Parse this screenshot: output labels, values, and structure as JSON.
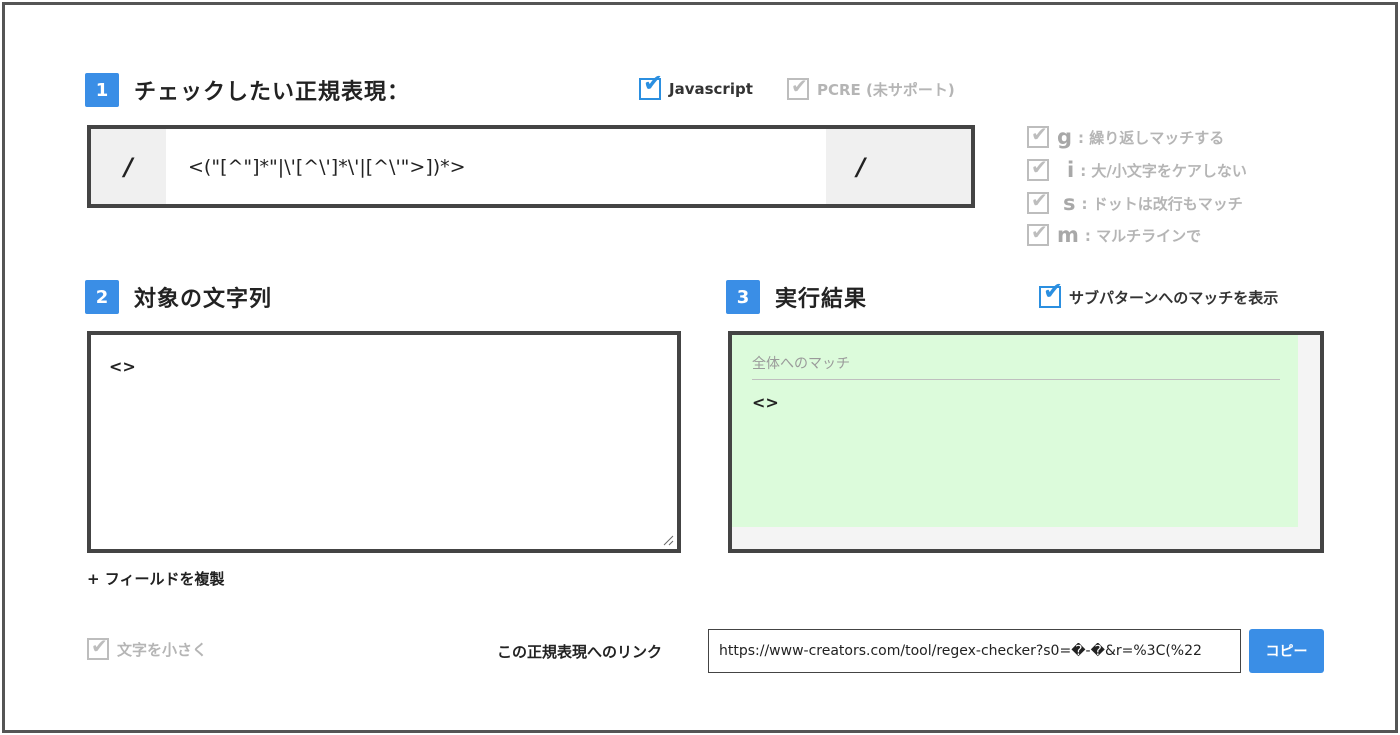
{
  "step1": {
    "number": "1",
    "title": "チェックしたい正規表現："
  },
  "engines": {
    "javascript": {
      "label": "Javascript",
      "checked": true
    },
    "pcre": {
      "label": "PCRE (未サポート)",
      "checked": true
    }
  },
  "regex": {
    "open_delim": "/",
    "pattern": "<(\"[^\"]*\"|\\'[^\\']*\\'|[^\\'\">])*>",
    "close_delim": "/"
  },
  "flags": [
    {
      "key": "g",
      "label": ": 繰り返しマッチする",
      "checked": true
    },
    {
      "key": "i",
      "label": ": 大/小文字をケアしない",
      "checked": true
    },
    {
      "key": "s",
      "label": ": ドットは改行もマッチ",
      "checked": true
    },
    {
      "key": "m",
      "label": ": マルチラインで",
      "checked": true
    }
  ],
  "step2": {
    "number": "2",
    "title": "対象の文字列"
  },
  "target": {
    "text": "<>"
  },
  "step3": {
    "number": "3",
    "title": "実行結果"
  },
  "submatch": {
    "label": "サブパターンへのマッチを表示",
    "checked": true
  },
  "result": {
    "header": "全体へのマッチ",
    "value": "<>"
  },
  "duplicate_label": "+ フィールドを複製",
  "small_text": {
    "label": "文字を小さく",
    "checked": true
  },
  "link": {
    "label": "この正規表現へのリンク",
    "url": "https://www-creators.com/tool/regex-checker?s0=�-�&r=%3C(%22"
  },
  "copy_label": "コピー",
  "colors": {
    "accent": "#3a8ee6",
    "result_bg": "#dcfbdb",
    "border": "#444444"
  }
}
